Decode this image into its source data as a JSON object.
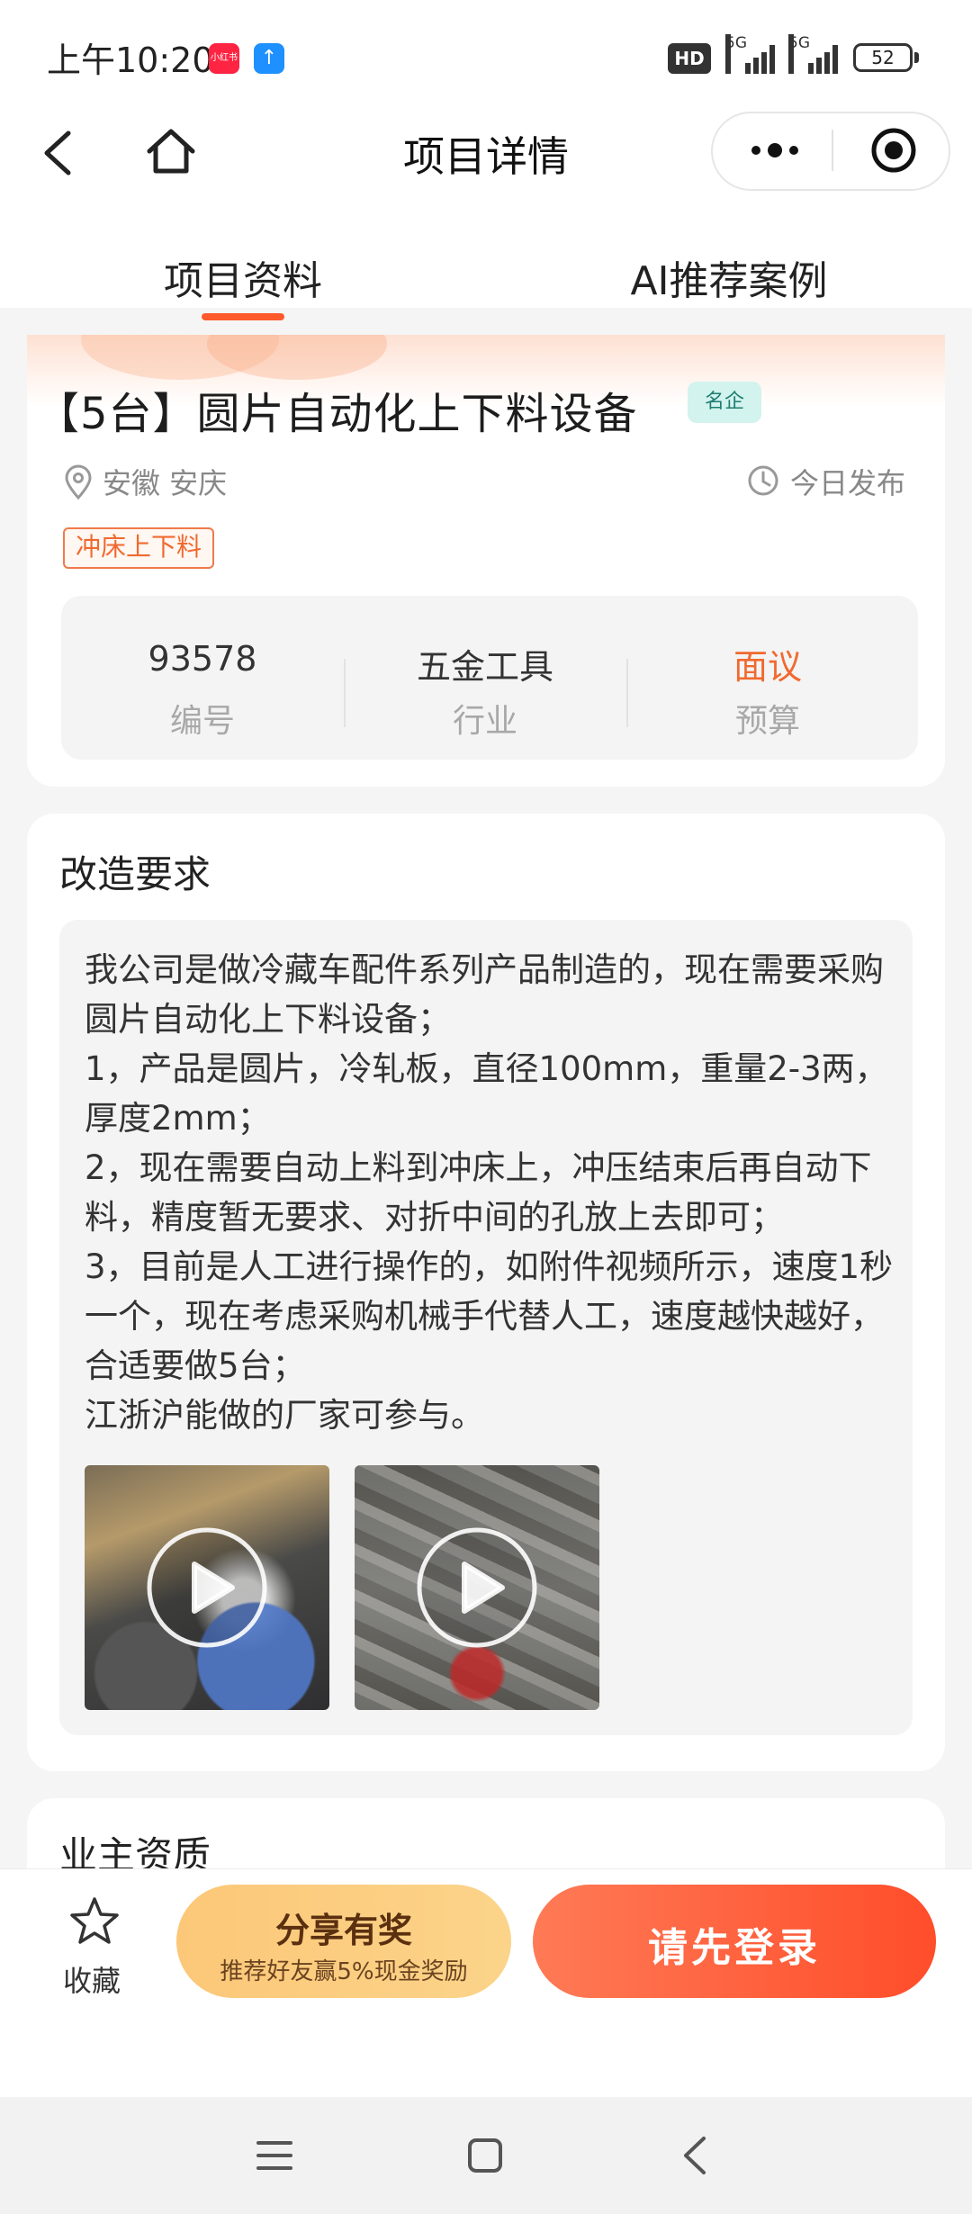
{
  "status_bar": {
    "time": "上午10:20",
    "app_icon_1": "小红书",
    "app_icon_2": "↑",
    "hd_label": "HD",
    "network_1": "5G",
    "network_2": "5G",
    "battery": "52"
  },
  "header": {
    "title": "项目详情",
    "back_icon": "back-arrow-icon",
    "home_icon": "home-icon",
    "more_icon": "more-dots-icon",
    "close_icon": "target-icon"
  },
  "tabs": [
    {
      "label": "项目资料",
      "active": true
    },
    {
      "label": "AI推荐案例",
      "active": false
    }
  ],
  "project": {
    "title": "【5台】圆片自动化上下料设备",
    "badge": "名企",
    "location": "安徽 安庆",
    "publish_time": "今日发布",
    "tag": "冲床上下料",
    "stats": [
      {
        "value": "93578",
        "label": "编号",
        "highlight": false
      },
      {
        "value": "五金工具",
        "label": "行业",
        "highlight": false
      },
      {
        "value": "面议",
        "label": "预算",
        "highlight": true
      }
    ]
  },
  "requirements": {
    "title": "改造要求",
    "description": "我公司是做冷藏车配件系列产品制造的，现在需要采购圆片自动化上下料设备；\n1，产品是圆片，冷轧板，直径100mm，重量2-3两，厚度2mm；\n2，现在需要自动上料到冲床上，冲压结束后再自动下料，精度暂无要求、对折中间的孔放上去即可；\n3，目前是人工进行操作的，如附件视频所示，速度1秒一个，现在考虑采购机械手代替人工，速度越快越好，合适要做5台；\n江浙沪能做的厂家可参与。"
  },
  "owner": {
    "title": "业主资质"
  },
  "actions": {
    "favorite_label": "收藏",
    "share_title": "分享有奖",
    "share_subtitle": "推荐好友赢5%现金奖励",
    "login_label": "请先登录"
  },
  "colors": {
    "accent": "#ff5a2c",
    "budget": "#f06a30",
    "share_bg": "#fcc778",
    "login_bg": "#ff4d2a",
    "badge_bg": "#d2f3ee"
  }
}
